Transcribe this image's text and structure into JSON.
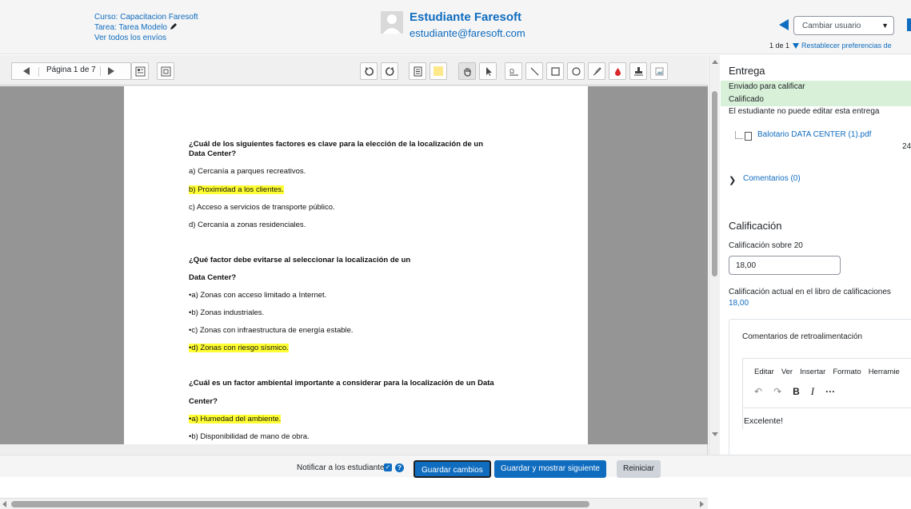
{
  "header": {
    "course": "Curso: Capacitacion Faresoft",
    "assignment": "Tarea: Tarea Modelo",
    "view_all": "Ver todos los envíos",
    "student_name": "Estudiante Faresoft",
    "student_email": "estudiante@faresoft.com",
    "change_user_placeholder": "Cambiar usuario",
    "user_count": "1 de 1",
    "reset_prefs": "Restablecer preferencias de"
  },
  "toolbar": {
    "page_label": "Página 1 de 7",
    "icons": [
      "prev-page-icon",
      "next-page-icon",
      "thumbnail-icon",
      "fullscreen-icon",
      "rotate-left-icon",
      "rotate-right-icon",
      "comment-icon",
      "color-icon",
      "pan-icon",
      "select-icon",
      "stamp-text-icon",
      "line-icon",
      "rectangle-icon",
      "oval-icon",
      "pen-icon",
      "highlight-icon",
      "stamp-icon",
      "image-icon"
    ],
    "color_swatch": "#fde98c"
  },
  "document": {
    "blocks": [
      {
        "text": "¿Cuál de los siguientes factores es clave para la elección de la localización de un",
        "bold": true,
        "highlight": false
      },
      {
        "text": "Data Center?",
        "bold": true,
        "highlight": false
      },
      {
        "text": "a) Cercanía a parques recreativos.",
        "bold": false,
        "highlight": false
      },
      {
        "text": "b) Proximidad a los clientes.",
        "bold": false,
        "highlight": true
      },
      {
        "text": "c) Acceso a servicios de transporte público.",
        "bold": false,
        "highlight": false
      },
      {
        "text": "d) Cercanía a zonas residenciales.",
        "bold": false,
        "highlight": false
      },
      {
        "text": "¿Qué factor debe evitarse al seleccionar la localización de un",
        "bold": true,
        "highlight": false
      },
      {
        "text": "Data Center?",
        "bold": true,
        "highlight": false
      },
      {
        "text": "•a) Zonas con acceso limitado a Internet.",
        "bold": false,
        "highlight": false
      },
      {
        "text": "•b) Zonas industriales.",
        "bold": false,
        "highlight": false
      },
      {
        "text": "•c) Zonas con infraestructura de energía estable.",
        "bold": false,
        "highlight": false
      },
      {
        "text": "•d) Zonas con riesgo sísmico.",
        "bold": false,
        "highlight": true
      },
      {
        "text": "¿Cuál es un factor ambiental importante a considerar para la localización de un Data",
        "bold": true,
        "highlight": false
      },
      {
        "text": "Center?",
        "bold": true,
        "highlight": false
      },
      {
        "text": "•a) Humedad del ambiente.",
        "bold": false,
        "highlight": true
      },
      {
        "text": "•b) Disponibilidad de mano de obra.",
        "bold": false,
        "highlight": false
      }
    ],
    "highlight_color": "#ffff33"
  },
  "panel": {
    "submission_title": "Entrega",
    "status_1": "Enviado para calificar",
    "status_2": "Calificado",
    "status_color": "#d7f0d7",
    "no_edit": "El estudiante no puede editar esta entrega",
    "file_name": "Balotario DATA CENTER (1).pdf",
    "file_date": "24",
    "comments": "Comentarios (0)",
    "grade_heading": "Calificación",
    "grade_out_of": "Calificación sobre 20",
    "grade_value": "18,00",
    "gradebook_label": "Calificación actual en el libro de calificaciones",
    "gradebook_value": "18,00",
    "feedback_title": "Comentarios de retroalimentación",
    "editor_menu": [
      "Editar",
      "Ver",
      "Insertar",
      "Formato",
      "Herramie"
    ],
    "editor_text": "Excelente!"
  },
  "footer": {
    "notify": "Notificar a los estudiantes",
    "save": "Guardar cambios",
    "save_next": "Guardar y mostrar siguiente",
    "reset": "Reiniciar"
  },
  "colors": {
    "accent": "#0f6cbf",
    "header_bg": "#f5f5f5"
  }
}
